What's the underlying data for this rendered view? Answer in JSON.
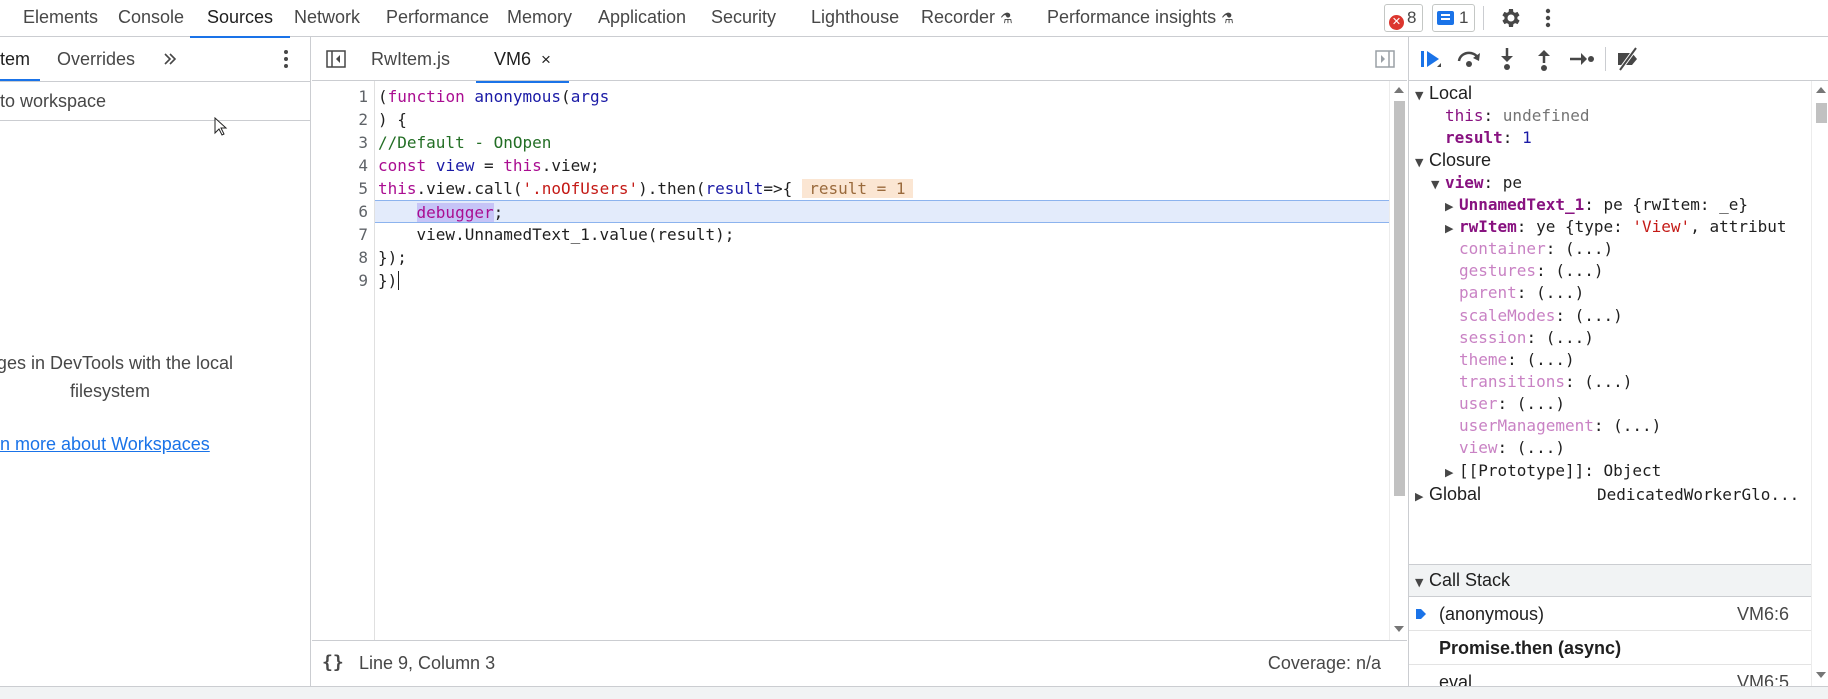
{
  "top_tabs": [
    "Elements",
    "Console",
    "Sources",
    "Network",
    "Performance",
    "Memory",
    "Application",
    "Security",
    "Lighthouse",
    "Recorder",
    "Performance insights"
  ],
  "active_tab": "Sources",
  "errors_count": "8",
  "messages_count": "1",
  "navigator": {
    "tabs": [
      "tem",
      "Overrides"
    ],
    "add_workspace": "to workspace",
    "info_line1": "nges in DevTools with the local",
    "info_line2": "filesystem",
    "learn_more": "n more about Workspaces"
  },
  "editor": {
    "files": [
      "RwItem.js",
      "VM6"
    ],
    "active_file": "VM6",
    "close_glyph": "×",
    "line_numbers": [
      "1",
      "2",
      "3",
      "4",
      "5",
      "6",
      "7",
      "8",
      "9"
    ],
    "line1": [
      "(",
      "function",
      " ",
      "anonymous",
      "(",
      "args"
    ],
    "line2": ") {",
    "line3": "//Default - OnOpen",
    "line4": [
      "const",
      " ",
      "view",
      " = ",
      "this",
      ".view;"
    ],
    "line5": [
      "this",
      ".view.call(",
      "'.noOfUsers'",
      ").then(",
      "result",
      "=>{"
    ],
    "inline_value": "result = 1",
    "line6": [
      "    ",
      "debugger",
      ";"
    ],
    "line7": "    view.UnnamedText_1.value(result);",
    "line8": "});",
    "line9": "})",
    "status_position": "Line 9, Column 3",
    "status_coverage": "Coverage: n/a",
    "format_glyph": "{}"
  },
  "scope": {
    "local_header": "Local",
    "this_key": "this",
    "this_val": "undefined",
    "result_key": "result",
    "result_val": "1",
    "closure_header": "Closure",
    "view_key": "view",
    "view_val": "pe",
    "unnamed_key": "UnnamedText_1",
    "unnamed_val": "pe {rwItem: _e}",
    "rwitem_key": "rwItem",
    "rwitem_val_pre": "ye {type: ",
    "rwitem_val_str": "'View'",
    "rwitem_val_post": ", attribut",
    "lazy_props": [
      "container",
      "gestures",
      "parent",
      "scaleModes",
      "session",
      "theme",
      "transitions",
      "user",
      "userManagement",
      "view"
    ],
    "lazy_value": "(...)",
    "prototype": "[[Prototype]]: Object",
    "global_header": "Global",
    "global_value": "DedicatedWorkerGlo..."
  },
  "call_stack": {
    "header": "Call Stack",
    "frames": [
      {
        "name": "(anonymous)",
        "location": "VM6:6"
      },
      {
        "name": "Promise.then (async)",
        "location": ""
      },
      {
        "name": "eval",
        "location": "VM6:5"
      }
    ]
  },
  "colors": {
    "accent": "#1a73e8",
    "error": "#dc362e",
    "exec_line": "#e3ebfb",
    "inline_value_bg": "#fbe6d3"
  }
}
